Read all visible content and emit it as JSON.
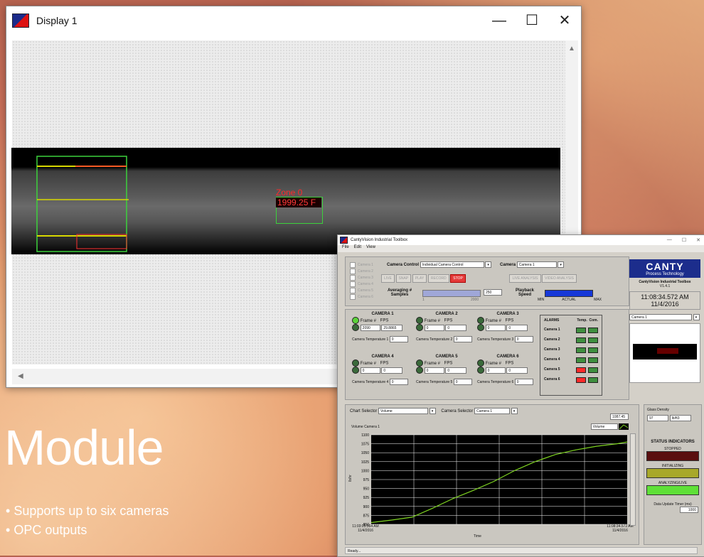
{
  "display_window": {
    "title": "Display 1",
    "zone_label": "Zone 0",
    "zone_value": "1999.25  F"
  },
  "slide": {
    "heading": "Module",
    "bullets": [
      "Supports up to six cameras",
      "OPC outputs"
    ]
  },
  "toolbox": {
    "title": "CantyVision Industrial Toolbox",
    "menu": [
      "File",
      "Edit",
      "View"
    ],
    "camera_checks": [
      "Camera 1",
      "Camera 2",
      "Camera 3",
      "Camera 4",
      "Camera 5",
      "Camera 6"
    ],
    "camera_control_label": "Camera Control",
    "camera_control_value": "Individual Camera Control",
    "camera_label": "Camera",
    "camera_value": "Camera 1",
    "buttons": [
      "LIVE",
      "SNAP",
      "PLAY",
      "RECORD",
      "STOP"
    ],
    "analysis_buttons": [
      "LIVE ANALYSIS",
      "VIDEO ANALYSIS"
    ],
    "averaging_label": "Averaging # Samples",
    "averaging_value": "250",
    "averaging_min": "1",
    "averaging_max": "2000",
    "playback_label": "Playback Speed",
    "playback_scale": [
      "MIN",
      "ACTUAL",
      "MAX"
    ],
    "cameras": [
      {
        "name": "CAMERA 1",
        "frame": "2090",
        "fps": "29.8865",
        "temp_label": "Camera Temperature 1",
        "temp": "0"
      },
      {
        "name": "CAMERA 2",
        "frame": "0",
        "fps": "0",
        "temp_label": "Camera Temperature 2",
        "temp": "0"
      },
      {
        "name": "CAMERA 3",
        "frame": "0",
        "fps": "0",
        "temp_label": "Camera Temperature 3",
        "temp": "0"
      },
      {
        "name": "CAMERA 4",
        "frame": "0",
        "fps": "0",
        "temp_label": "Camera Temperature 4",
        "temp": "0"
      },
      {
        "name": "CAMERA 5",
        "frame": "0",
        "fps": "0",
        "temp_label": "Camera Temperature 5",
        "temp": "0"
      },
      {
        "name": "CAMERA 6",
        "frame": "0",
        "fps": "0",
        "temp_label": "Camera Temperature 6",
        "temp": "0"
      }
    ],
    "frame_label": "Frame #",
    "fps_label": "FPS",
    "alarms": {
      "title": "ALARMS",
      "col_temp": "Temp.",
      "col_comm": "Com.",
      "rows": [
        {
          "name": "Camera 1",
          "temp": "green",
          "comm": "green"
        },
        {
          "name": "Camera 2",
          "temp": "green",
          "comm": "green"
        },
        {
          "name": "Camera 3",
          "temp": "green",
          "comm": "green"
        },
        {
          "name": "Camera 4",
          "temp": "green",
          "comm": "green"
        },
        {
          "name": "Camera 5",
          "temp": "red",
          "comm": "green"
        },
        {
          "name": "Camera 6",
          "temp": "red",
          "comm": "green"
        }
      ]
    },
    "logo_top": "CANTY",
    "logo_bottom": "Process Technology",
    "product_name": "CantyVision Industrial Toolbox",
    "version": "V1.4.1",
    "clock_time": "11:08:34.572 AM",
    "clock_date": "11/4/2016",
    "preview_camera": "Camera 1",
    "chart_selector_label": "Chart Selector",
    "chart_selector_value": "Volume",
    "camera_selector_label": "Camera Selector",
    "camera_selector_value": "Camera 1",
    "glass_density_label": "Glass Density",
    "glass_density_value": "97",
    "glass_density_unit": "lb/ft3",
    "status_indicators_title": "STATUS INDICATORS",
    "status_stopped": "STOPPED",
    "status_initializing": "INITIALIZING",
    "status_analyzing": "ANALYZING/LIVE",
    "update_timer_label": "Data Update Timer (ms)",
    "update_timer_value": "1000",
    "status_bar": "Ready..."
  },
  "chart_data": {
    "type": "line",
    "title": "Volume Camera 1",
    "xlabel": "Time",
    "ylabel": "lb/hr",
    "legend": "Volume",
    "current_value": "1087.45",
    "x_start_label": "11:03:05.564 AM 11/4/2016",
    "x_end_label": "11:08:34.572 AM 11/4/2016",
    "ylim": [
      850,
      1100
    ],
    "yticks": [
      850,
      875,
      900,
      925,
      950,
      975,
      1000,
      1025,
      1050,
      1075,
      1100
    ],
    "series": [
      {
        "name": "Volume",
        "x": [
          0,
          0.08,
          0.16,
          0.24,
          0.32,
          0.4,
          0.48,
          0.56,
          0.64,
          0.72,
          0.8,
          0.88,
          0.96,
          1.0
        ],
        "y": [
          855,
          862,
          870,
          895,
          922,
          945,
          970,
          1000,
          1025,
          1045,
          1058,
          1068,
          1075,
          1080
        ]
      }
    ],
    "colors": {
      "line": "#7ed321",
      "background": "#000000",
      "grid": "#ffffff"
    }
  }
}
